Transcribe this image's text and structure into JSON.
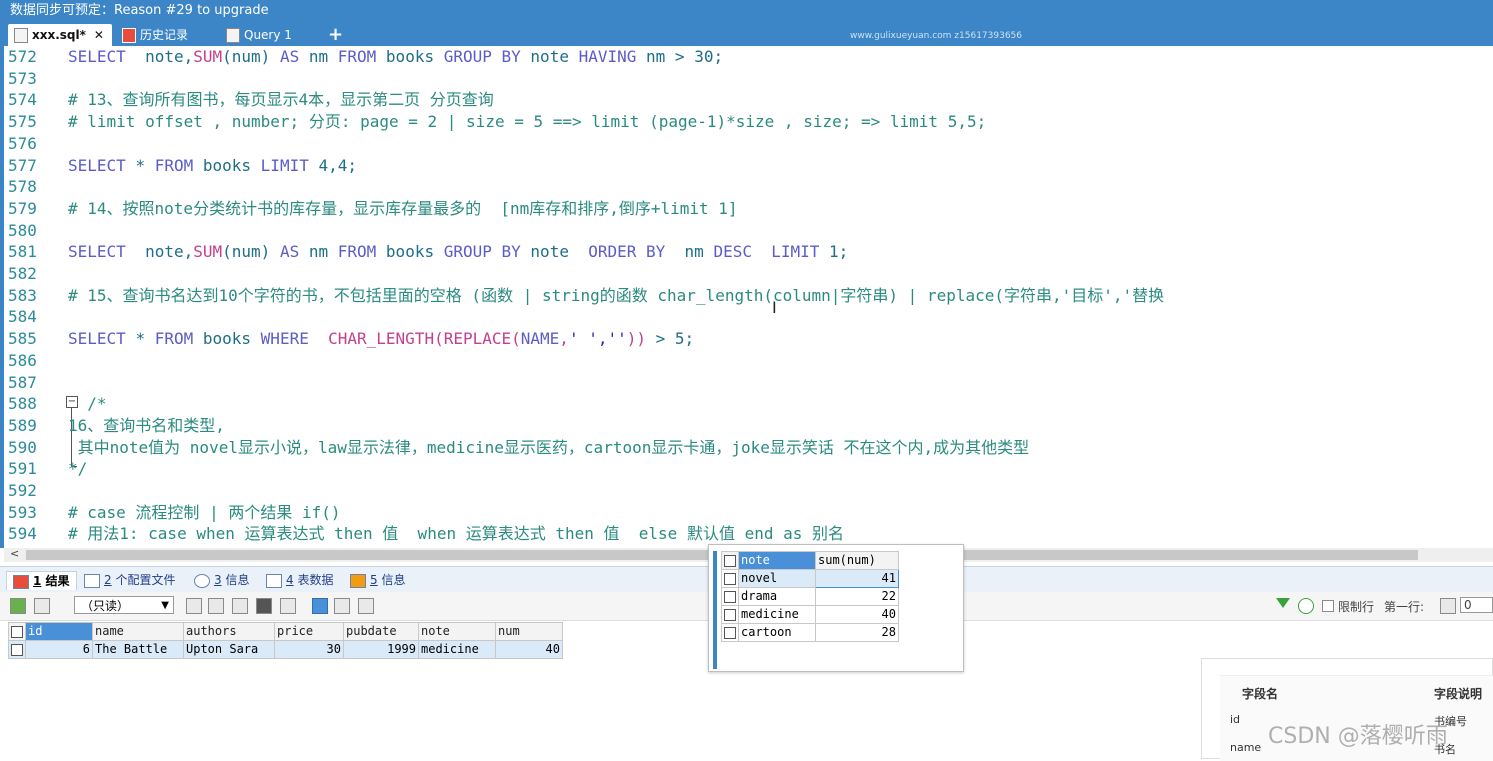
{
  "window": {
    "title": "数据同步可预定：Reason #29 to upgrade"
  },
  "tabs": [
    {
      "label": "xxx.sql*",
      "close": "✕"
    },
    {
      "label": "历史记录"
    },
    {
      "label": "Query 1"
    }
  ],
  "tab_add": "+",
  "watermark_top": "www.gulixueyuan.com z15617393656",
  "editor": {
    "lines": [
      {
        "n": "572",
        "parts": [
          [
            "kw",
            "SELECT  "
          ],
          [
            "code",
            "note,"
          ],
          [
            "fn",
            "SUM"
          ],
          [
            "code",
            "(num) "
          ],
          [
            "kw",
            "AS "
          ],
          [
            "code",
            "nm "
          ],
          [
            "kw",
            "FROM "
          ],
          [
            "code",
            "books "
          ],
          [
            "kw",
            "GROUP BY "
          ],
          [
            "code",
            "note "
          ],
          [
            "kw",
            "HAVING "
          ],
          [
            "code",
            "nm > 30;"
          ]
        ]
      },
      {
        "n": "573",
        "parts": []
      },
      {
        "n": "574",
        "parts": [
          [
            "cm",
            "# 13、查询所有图书，每页显示4本，显示第二页 分页查询"
          ]
        ]
      },
      {
        "n": "575",
        "parts": [
          [
            "cm",
            "# limit offset , number; 分页: page = 2 | size = 5 ==> limit (page-1)*size , size; => limit 5,5;"
          ]
        ]
      },
      {
        "n": "576",
        "parts": []
      },
      {
        "n": "577",
        "parts": [
          [
            "kw",
            "SELECT "
          ],
          [
            "code",
            "* "
          ],
          [
            "kw",
            "FROM "
          ],
          [
            "code",
            "books "
          ],
          [
            "kw",
            "LIMIT "
          ],
          [
            "code",
            "4,4;"
          ]
        ]
      },
      {
        "n": "578",
        "parts": []
      },
      {
        "n": "579",
        "parts": [
          [
            "cm",
            "# 14、按照note分类统计书的库存量，显示库存量最多的  [nm库存和排序,倒序+limit 1]"
          ]
        ]
      },
      {
        "n": "580",
        "parts": []
      },
      {
        "n": "581",
        "parts": [
          [
            "kw",
            "SELECT  "
          ],
          [
            "code",
            "note,"
          ],
          [
            "fn",
            "SUM"
          ],
          [
            "code",
            "(num) "
          ],
          [
            "kw",
            "AS "
          ],
          [
            "code",
            "nm "
          ],
          [
            "kw",
            "FROM "
          ],
          [
            "code",
            "books "
          ],
          [
            "kw",
            "GROUP BY "
          ],
          [
            "code",
            "note  "
          ],
          [
            "kw",
            "ORDER BY  "
          ],
          [
            "code",
            "nm "
          ],
          [
            "kw",
            "DESC  LIMIT "
          ],
          [
            "code",
            "1;"
          ]
        ]
      },
      {
        "n": "582",
        "parts": []
      },
      {
        "n": "583",
        "parts": [
          [
            "cm",
            "# 15、查询书名达到10个字符的书，不包括里面的空格 (函数 | string的函数 char_length(column|字符串) | replace(字符串,'目标','替换"
          ]
        ]
      },
      {
        "n": "584",
        "parts": []
      },
      {
        "n": "585",
        "parts": [
          [
            "kw",
            "SELECT "
          ],
          [
            "code",
            "* "
          ],
          [
            "kw",
            "FROM "
          ],
          [
            "code",
            "books "
          ],
          [
            "kw",
            "WHERE  "
          ],
          [
            "fn",
            "CHAR_LENGTH(REPLACE("
          ],
          [
            "kw",
            "NAME"
          ],
          [
            "fn",
            ","
          ],
          [
            "st",
            "' ',''"
          ],
          [
            "fn",
            "))"
          ],
          [
            "code",
            " > 5;"
          ]
        ]
      },
      {
        "n": "586",
        "parts": []
      },
      {
        "n": "587",
        "parts": []
      },
      {
        "n": "588",
        "parts": [
          [
            "cm",
            "  /*"
          ]
        ]
      },
      {
        "n": "589",
        "parts": [
          [
            "cm",
            "16、查询书名和类型,"
          ]
        ]
      },
      {
        "n": "590",
        "parts": [
          [
            "cm",
            " 其中note值为 novel显示小说，law显示法律，medicine显示医药，cartoon显示卡通，joke显示笑话 不在这个内,成为其他类型"
          ]
        ]
      },
      {
        "n": "591",
        "parts": [
          [
            "cm",
            "*/"
          ]
        ]
      },
      {
        "n": "592",
        "parts": []
      },
      {
        "n": "593",
        "parts": [
          [
            "cm",
            "# case 流程控制 | 两个结果 if()"
          ]
        ]
      },
      {
        "n": "594",
        "parts": [
          [
            "cm",
            "# 用法1: case when 运算表达式 then 值  when 运算表达式 then 值  else 默认值 end as 别名"
          ]
        ]
      }
    ]
  },
  "result_tabs": [
    {
      "num": "1",
      "label": " 结果"
    },
    {
      "num": "2",
      "label": " 个配置文件"
    },
    {
      "num": "3",
      "label": " 信息"
    },
    {
      "num": "4",
      "label": " 表数据"
    },
    {
      "num": "5",
      "label": " 信息"
    }
  ],
  "toolbar": {
    "readonly": "（只读）",
    "limit_rows": "限制行",
    "first_row": "第一行:",
    "first_row_value": "0"
  },
  "result_grid": {
    "columns": [
      "id",
      "name",
      "authors",
      "price",
      "pubdate",
      "note",
      "num"
    ],
    "rows": [
      [
        "6",
        "The Battle",
        "Upton Sara",
        "30",
        "1999",
        "medicine",
        "40"
      ]
    ]
  },
  "popup_grid": {
    "columns": [
      "note",
      "sum(num)"
    ],
    "rows": [
      [
        "novel",
        "41"
      ],
      [
        "drama",
        "22"
      ],
      [
        "medicine",
        "40"
      ],
      [
        "cartoon",
        "28"
      ]
    ]
  },
  "side_panel": {
    "col1": "字段名",
    "col2": "字段说明",
    "r1c1": "id",
    "r1c2": "书编号",
    "r2c1": "name",
    "r2c2": "书名"
  },
  "watermark": "CSDN @落樱听雨"
}
